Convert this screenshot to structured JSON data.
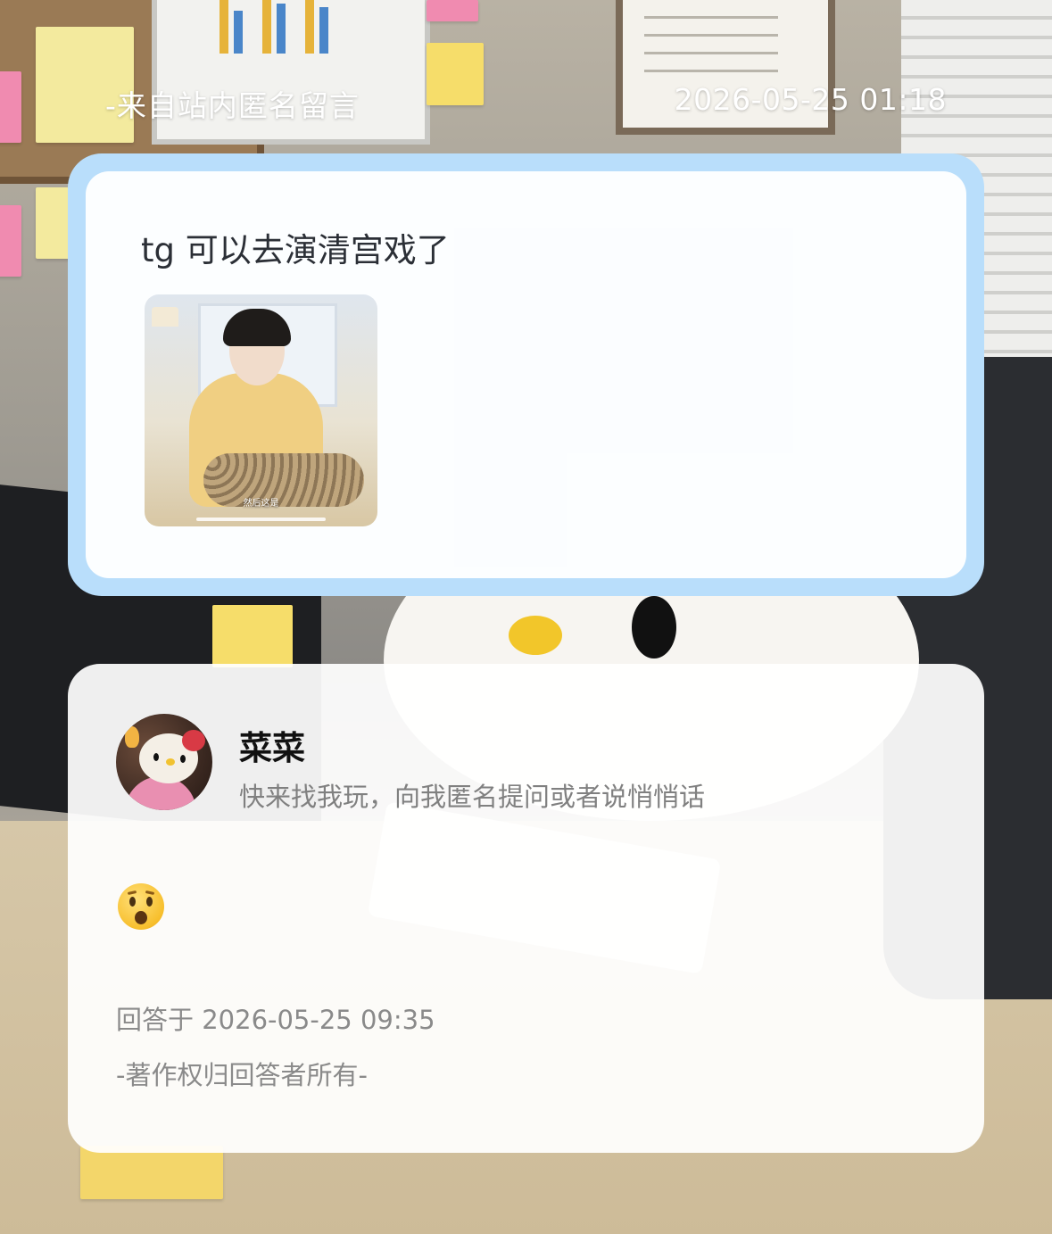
{
  "header": {
    "source_label": "-来自站内匿名留言",
    "timestamp": "2026-05-25 01:18"
  },
  "question": {
    "text": "tg 可以去演清宫戏了",
    "image": {
      "caption": "然后这是",
      "icon": "video-thumbnail"
    }
  },
  "answer": {
    "author_name": "菜菜",
    "author_bio": "快来找我玩，向我匿名提问或者说悄悄话",
    "avatar_icon": "hello-kitty-avatar",
    "reply_icon": "astonished-face-emoji",
    "answered_at": "回答于 2026-05-25 09:35",
    "copyright": "-著作权归回答者所有-"
  },
  "colors": {
    "card_border": "#b9defb",
    "header_text": "#ffffff",
    "meta_text": "#8a8a8a"
  }
}
